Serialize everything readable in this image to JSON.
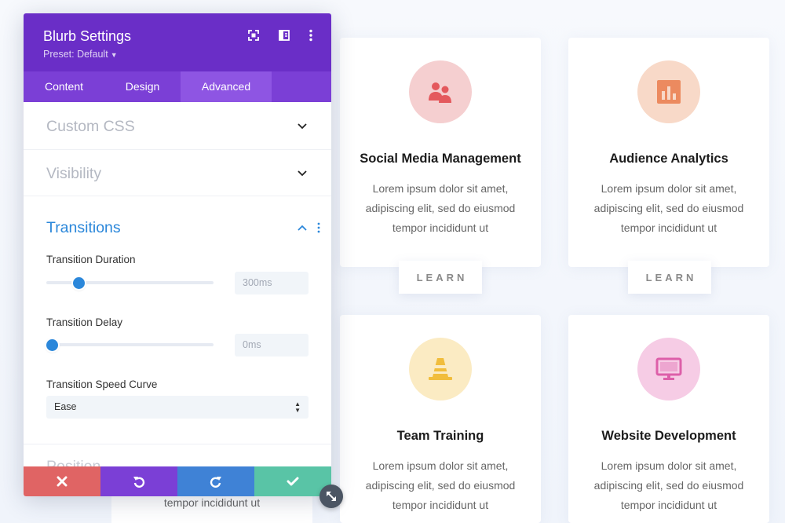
{
  "panel": {
    "title": "Blurb Settings",
    "preset": "Preset: Default",
    "header_icons": [
      "focus-icon",
      "split-view-icon",
      "more-options-icon"
    ],
    "tabs": [
      {
        "label": "Content",
        "active": false
      },
      {
        "label": "Design",
        "active": false
      },
      {
        "label": "Advanced",
        "active": true
      }
    ],
    "sections": {
      "custom_css": "Custom CSS",
      "visibility": "Visibility",
      "transitions": "Transitions",
      "position": "Position"
    },
    "transitions": {
      "duration": {
        "label": "Transition Duration",
        "placeholder": "300ms",
        "slider_fraction": 0.17
      },
      "delay": {
        "label": "Transition Delay",
        "placeholder": "0ms",
        "slider_fraction": 0.0
      },
      "speed_curve": {
        "label": "Transition Speed Curve",
        "value": "Ease"
      }
    },
    "footer": {
      "buttons": [
        "discard",
        "undo",
        "redo",
        "save"
      ],
      "colors": {
        "discard": "#e06464",
        "undo": "#7b3fd6",
        "redo": "#3f82d6",
        "save": "#59c4a6"
      }
    }
  },
  "colors": {
    "header": "#6a2ec7",
    "tabs": "#7b3fd6",
    "active_tab": "#8e55e3",
    "accent_blue": "#2b87da"
  },
  "cards": [
    {
      "title": "Social Media Management",
      "body": "Lorem ipsum dolor sit amet, adipiscing elit, sed do eiusmod tempor incididunt ut",
      "icon": "users-icon",
      "icon_bg": "#f5cfd0",
      "icon_color": "#e4595d",
      "button": "LEARN"
    },
    {
      "title": "Audience Analytics",
      "body": "Lorem ipsum dolor sit amet, adipiscing elit, sed do eiusmod tempor incididunt ut",
      "icon": "bar-chart-icon",
      "icon_bg": "#f8d9c8",
      "icon_color": "#ec8a5f",
      "button": "LEARN"
    },
    {
      "title": "Team Training",
      "body": "Lorem ipsum dolor sit amet, adipiscing elit, sed do eiusmod tempor incididunt ut",
      "icon": "traffic-cone-icon",
      "icon_bg": "#fbebc3",
      "icon_color": "#f1bd3c"
    },
    {
      "title": "Website Development",
      "body": "Lorem ipsum dolor sit amet, adipiscing elit, sed do eiusmod tempor incididunt ut",
      "icon": "monitor-icon",
      "icon_bg": "#f6cce5",
      "icon_color": "#dd5fa9"
    }
  ],
  "hidden_card_text": "tempor incididunt ut"
}
